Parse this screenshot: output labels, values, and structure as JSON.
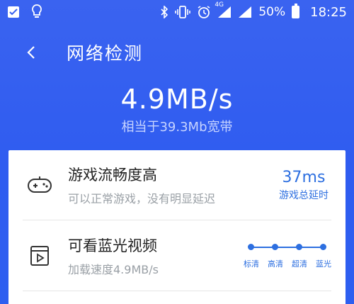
{
  "status_bar": {
    "network": "4G",
    "battery_percent": "50%",
    "time": "18:25",
    "icons": [
      "checkbox-icon",
      "lightbulb-icon",
      "bluetooth-icon",
      "vibrate-icon",
      "alarm-icon",
      "signal-icon",
      "signal-icon",
      "battery-icon"
    ]
  },
  "app_bar": {
    "title": "网络检测"
  },
  "result": {
    "speed": "4.9MB/s",
    "equivalent": "相当于39.3Mb宽带"
  },
  "items": [
    {
      "title": "游戏流畅度高",
      "subtitle": "可以正常游戏，没有明显延迟",
      "value": "37ms",
      "value_label": "游戏总延时"
    },
    {
      "title": "可看蓝光视频",
      "subtitle": "加载速度4.9MB/s",
      "quality_levels": [
        "标清",
        "高清",
        "超清",
        "蓝光"
      ]
    }
  ],
  "colors": {
    "accent": "#2d6fe0",
    "header_bg": "#2f5cf0"
  }
}
